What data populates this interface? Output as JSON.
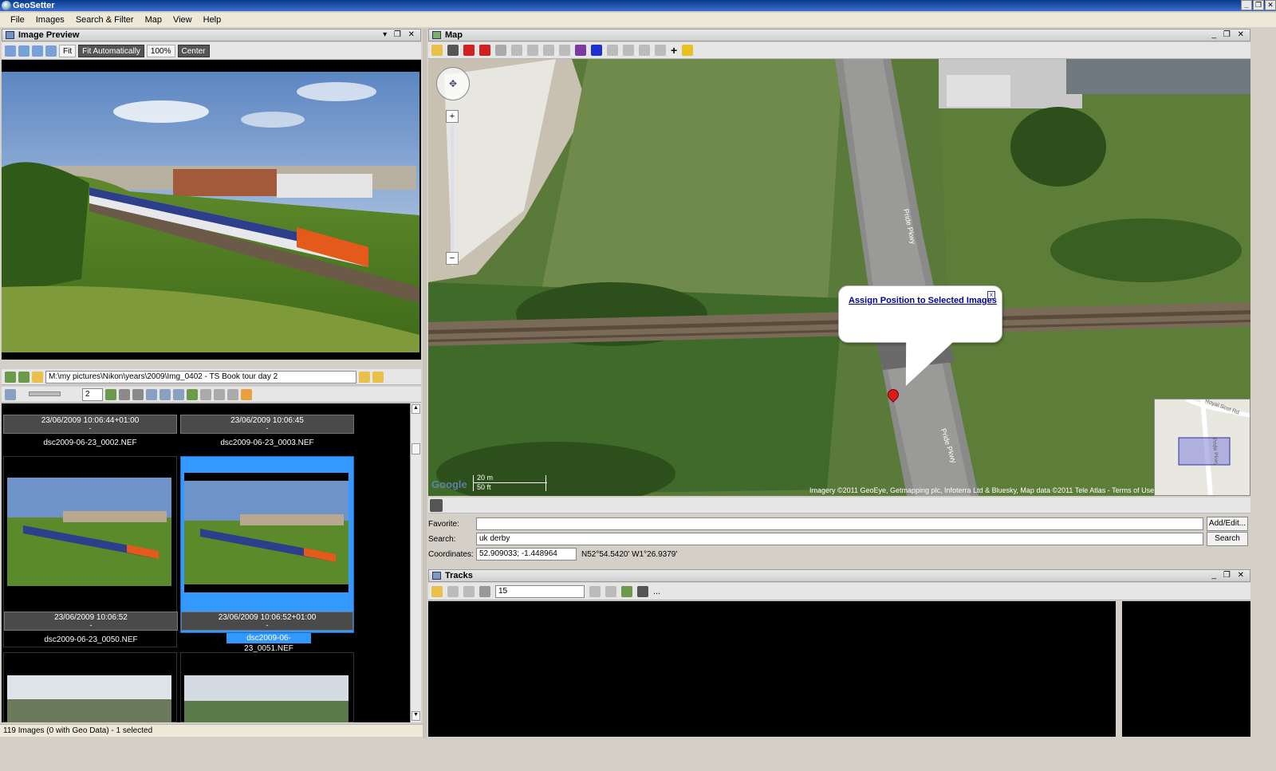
{
  "window": {
    "title": "GeoSetter"
  },
  "menu": [
    "File",
    "Images",
    "Search & Filter",
    "Map",
    "View",
    "Help"
  ],
  "preview_panel": {
    "title": "Image Preview",
    "toolbar": {
      "fit": "Fit",
      "fit_auto": "Fit Automatically",
      "zoom": "100%",
      "center": "Center"
    }
  },
  "browser": {
    "path": "M:\\my pictures\\Nikon\\years\\2009\\Img_0402 - TS Book tour day 2",
    "size_value": "2"
  },
  "thumbnails": [
    {
      "date": "23/06/2009 10:06:44+01:00",
      "sub": "-",
      "file": "dsc2009-06-23_0002.NEF",
      "selected": false
    },
    {
      "date": "23/06/2009 10:06:45",
      "sub": "-",
      "file": "dsc2009-06-23_0003.NEF",
      "selected": false
    },
    {
      "date": "23/06/2009 10:06:52",
      "sub": "-",
      "file": "dsc2009-06-23_0050.NEF",
      "selected": false
    },
    {
      "date": "23/06/2009 10:06:52+01:00",
      "sub": "-",
      "file": "dsc2009-06-23_0051.NEF",
      "selected": true
    }
  ],
  "status": {
    "text": "119 Images (0 with Geo Data) - 1 selected"
  },
  "map_panel": {
    "title": "Map",
    "popup_link": "Assign Position to Selected Images",
    "popup_close": "x",
    "scale_top": "20 m",
    "scale_bottom": "50 ft",
    "attribution": "Imagery ©2011 GeoEye, Getmapping plc, Infoterra Ltd & Bluesky, Map data ©2011 Tele Atlas - Terms of Use",
    "google": "Google",
    "road_label_1": "Pride Pkwy",
    "road_label_2": "Pride Pkwy",
    "overview_road": "Royal Scot Rd",
    "overview_road_2": "Pride Pkwy"
  },
  "location_form": {
    "favorite_label": "Favorite:",
    "favorite_value": "",
    "add_edit_button": "Add/Edit...",
    "search_label": "Search:",
    "search_value": "uk derby",
    "search_button": "Search",
    "coordinates_label": "Coordinates:",
    "coordinates_value": "52.909033; -1.448964",
    "coordinates_dms": "N52°54.5420' W1°26.9379'"
  },
  "tracks_panel": {
    "title": "Tracks",
    "combo_value": "15",
    "more": "..."
  },
  "colors": {
    "selection": "#3399ff",
    "titlebar": "#0a3a8c",
    "link": "#00008b"
  }
}
